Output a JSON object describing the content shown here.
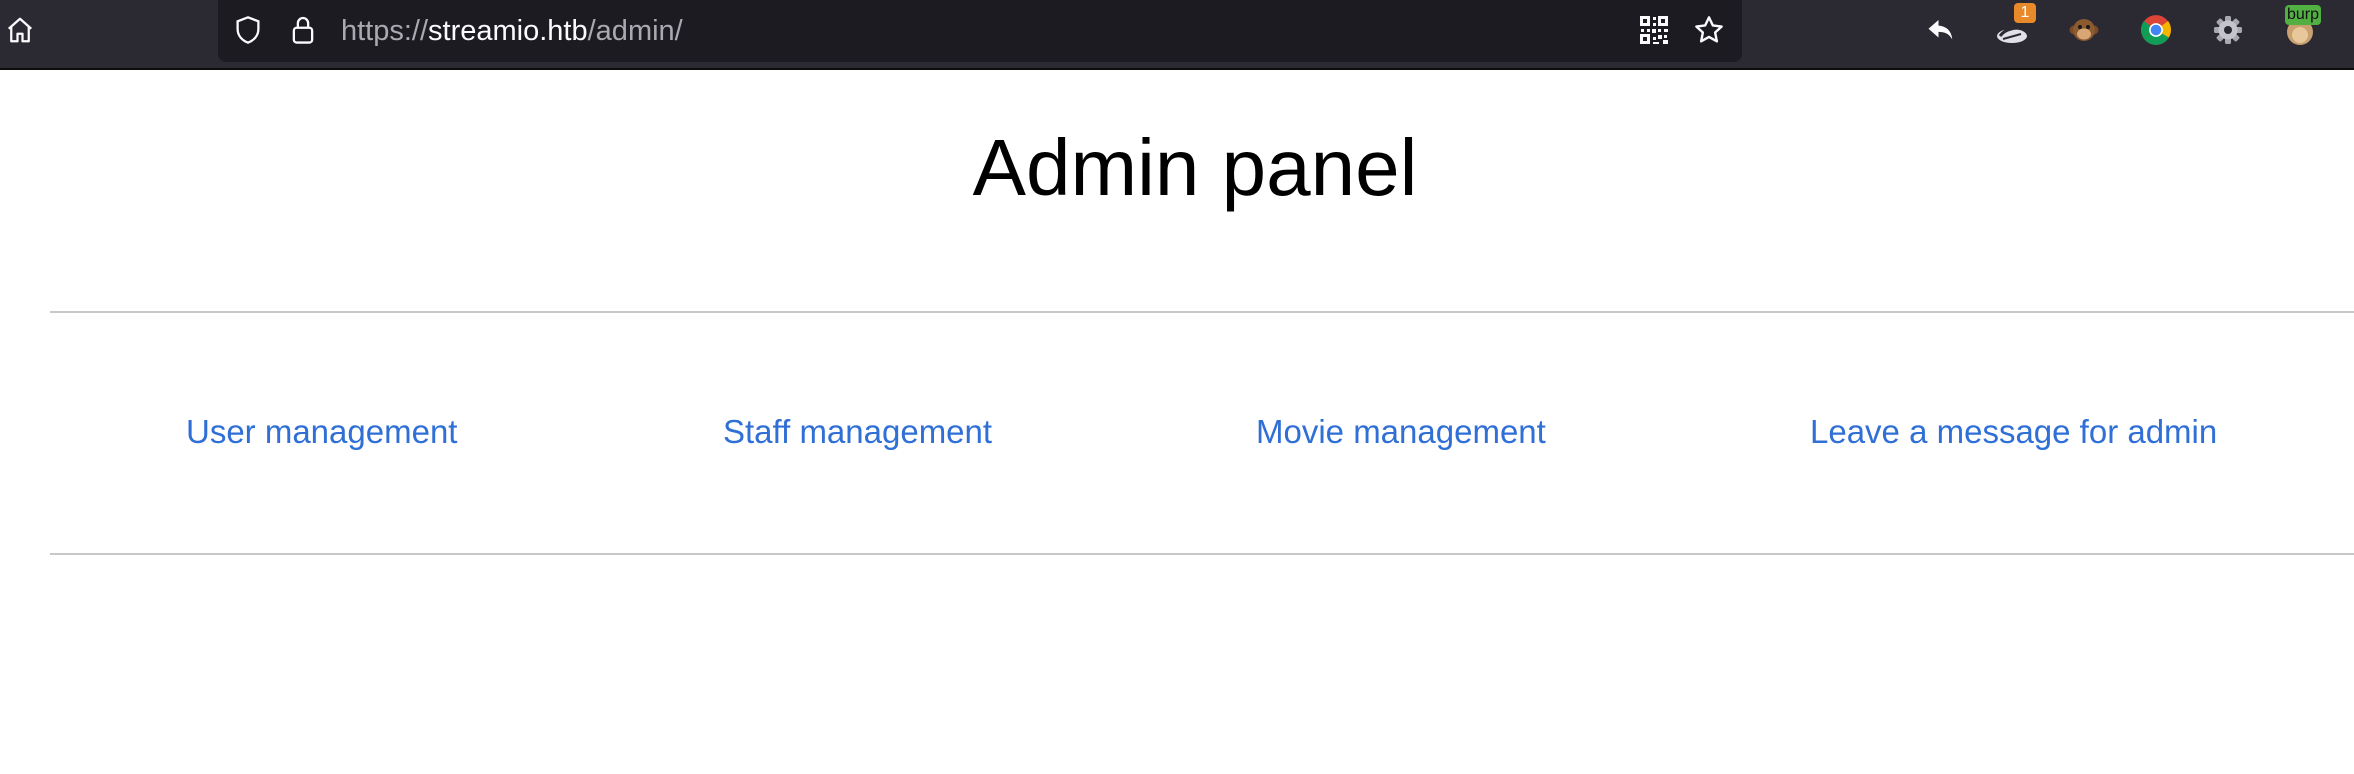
{
  "browser": {
    "url_scheme": "https://",
    "url_host": "streamio.htb",
    "url_path": "/admin/",
    "burp_badge": "burp",
    "extension_badge_count": "1"
  },
  "page": {
    "title": "Admin panel",
    "links": [
      {
        "label": "User management"
      },
      {
        "label": "Staff management"
      },
      {
        "label": "Movie management"
      },
      {
        "label": "Leave a message for admin"
      }
    ]
  },
  "colors": {
    "link": "#2f6fd6",
    "toolbar": "#2b2a33",
    "urlbar": "#1c1b22",
    "badge_orange": "#e8892a",
    "badge_green": "#52b043"
  }
}
